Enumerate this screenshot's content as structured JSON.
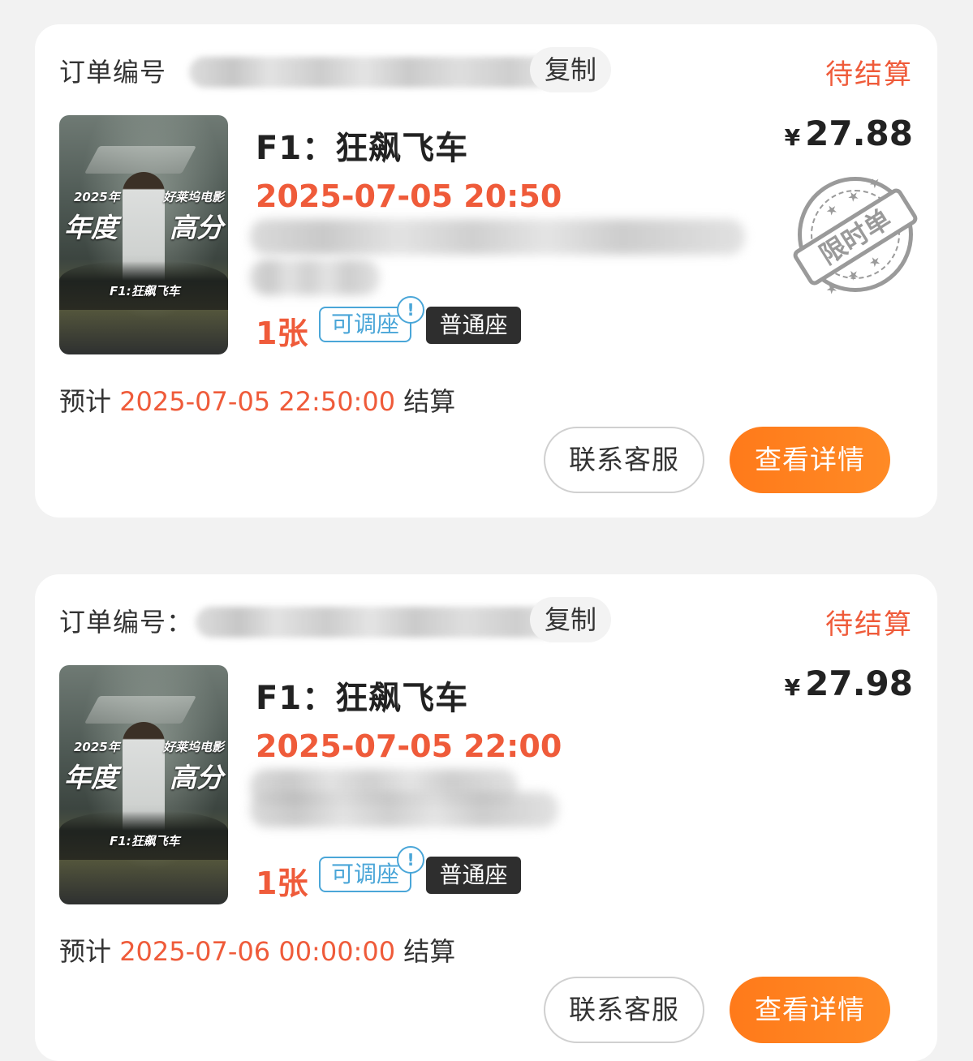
{
  "orders": [
    {
      "order_no_label": "订单编号",
      "copy_label": "复制",
      "status": "待结算",
      "movie_title": "F1：狂飙飞车",
      "showtime": "2025-07-05 20:50",
      "ticket_count": "1张",
      "adjust_seat_tag": "可调座",
      "alert_mark": "!",
      "seat_type": "普通座",
      "currency": "¥",
      "price": "27.88",
      "stamp_text": "限时单",
      "stamp_stars": "★ ★ ★",
      "settle_prefix": "预计 ",
      "settle_time": "2025-07-05 22:50:00",
      "settle_suffix": " 结算",
      "service_button": "联系客服",
      "detail_button": "查看详情",
      "poster": {
        "year_text": "2025年",
        "studio_text": "好莱坞电影",
        "badge_left": "年度",
        "badge_right": "高分",
        "poster_title": "F1:狂飙飞车"
      }
    },
    {
      "order_no_label": "订单编号：",
      "copy_label": "复制",
      "status": "待结算",
      "movie_title": "F1：狂飙飞车",
      "showtime": "2025-07-05 22:00",
      "ticket_count": "1张",
      "adjust_seat_tag": "可调座",
      "alert_mark": "!",
      "seat_type": "普通座",
      "currency": "¥",
      "price": "27.98",
      "settle_prefix": "预计 ",
      "settle_time": "2025-07-06 00:00:00",
      "settle_suffix": " 结算",
      "service_button": "联系客服",
      "detail_button": "查看详情",
      "poster": {
        "year_text": "2025年",
        "studio_text": "好莱坞电影",
        "badge_left": "年度",
        "badge_right": "高分",
        "poster_title": "F1:狂飙飞车"
      }
    }
  ],
  "colors": {
    "accent": "#ef5b3a",
    "button_orange": "#ff7a1a",
    "tag_blue": "#4aa6d8",
    "seat_tag_bg": "#2e2e2e"
  }
}
